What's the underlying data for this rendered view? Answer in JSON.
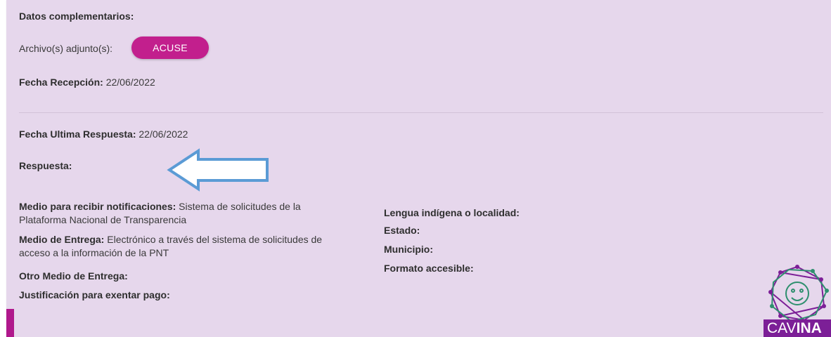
{
  "section_title": "Datos complementarios:",
  "attachments": {
    "label": "Archivo(s) adjunto(s):",
    "button_label": "ACUSE"
  },
  "reception": {
    "label": "Fecha Recepción:",
    "value": "22/06/2022"
  },
  "last_response": {
    "label": "Fecha Ultima Respuesta:",
    "value": "22/06/2022"
  },
  "response": {
    "label": "Respuesta:"
  },
  "left_fields": {
    "notifications": {
      "label": "Medio para recibir notificaciones:",
      "value": "Sistema de solicitudes de la Plataforma Nacional de Transparencia"
    },
    "delivery": {
      "label": "Medio de Entrega:",
      "value": "Electrónico a través del sistema de solicitudes de acceso a la información de la PNT"
    },
    "other_delivery": {
      "label": "Otro Medio de Entrega:"
    },
    "justification": {
      "label": "Justificación para exentar pago:"
    }
  },
  "right_fields": {
    "language": {
      "label": "Lengua indígena o localidad:"
    },
    "state": {
      "label": "Estado:"
    },
    "municipality": {
      "label": "Municipio:"
    },
    "format": {
      "label": "Formato accesible:"
    }
  },
  "logo": {
    "text_light": "CAV",
    "text_bold": "INA"
  },
  "colors": {
    "panel_bg": "#e6d7ec",
    "button": "#c21f8d",
    "arrow_stroke": "#5b9bd5",
    "logo_purple": "#7c1f97",
    "logo_green": "#2e8f6e"
  }
}
